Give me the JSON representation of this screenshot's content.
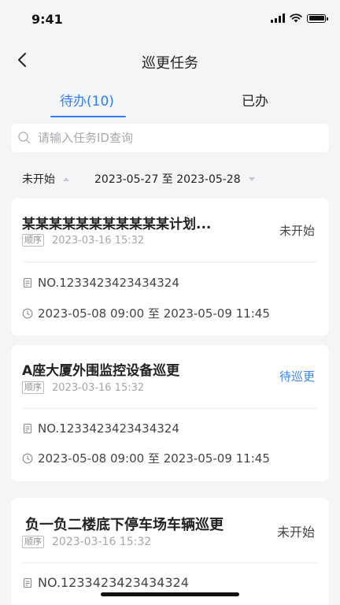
{
  "status_bar": {
    "time": "9:41"
  },
  "nav": {
    "title": "巡更任务"
  },
  "tabs": [
    {
      "label": "待办(10)",
      "active": true
    },
    {
      "label": "已办",
      "active": false
    }
  ],
  "search": {
    "placeholder": "请输入任务ID查询",
    "value": ""
  },
  "filters": {
    "status": "未开始",
    "date_range": "2023-05-27 至 2023-05-28"
  },
  "colors": {
    "accent": "#2f7ef7",
    "background": "#f4f5f7",
    "pending_blue": "#3c86e8",
    "muted": "#a4a6ab"
  },
  "tasks": [
    {
      "title": "某某某某某某某某某某某计划...",
      "status": "未开始",
      "order_tag": "顺序",
      "created": "2023-03-16 15:32",
      "number": "NO.1233423423434324",
      "time_range": "2023-05-08 09:00 至 2023-05-09 11:45"
    },
    {
      "title": "A座大厦外围监控设备巡更",
      "status": "待巡更",
      "order_tag": "顺序",
      "created": "2023-03-16 15:32",
      "number": "NO.1233423423434324",
      "time_range": "2023-05-08 09:00 至 2023-05-09 11:45"
    },
    {
      "title": "负一负二楼底下停车场车辆巡更",
      "status": "未开始",
      "order_tag": "顺序",
      "created": "2023-03-16 15:32",
      "number": "NO.1233423423434324",
      "time_range": ""
    }
  ]
}
